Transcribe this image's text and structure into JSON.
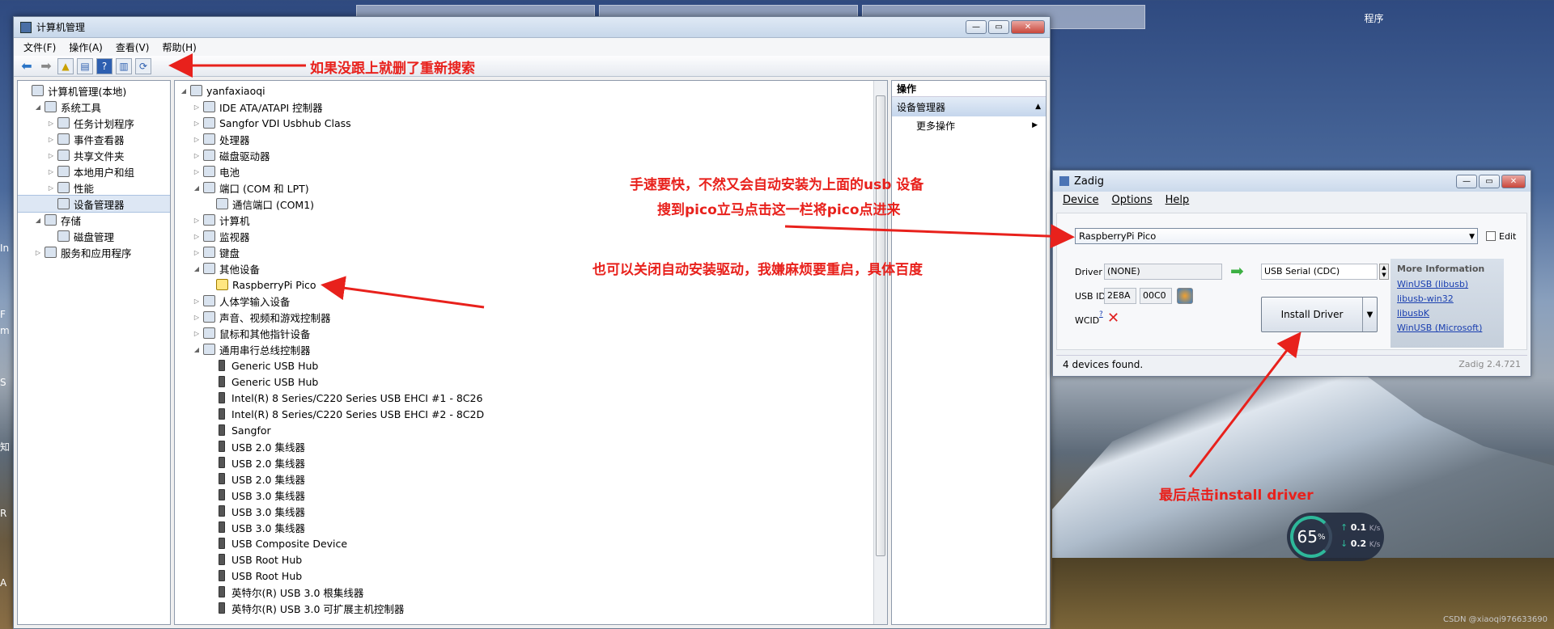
{
  "desktop": {
    "program_label": "程序",
    "left_edge": [
      "In",
      "F",
      "m",
      "S",
      "知",
      "R",
      "A"
    ],
    "watermark": "CSDN @xiaoqi976633690"
  },
  "devmgmt": {
    "title": "计算机管理",
    "menu": [
      "文件(F)",
      "操作(A)",
      "查看(V)",
      "帮助(H)"
    ],
    "left_tree": [
      {
        "label": "计算机管理(本地)",
        "indent": 0,
        "tri": ""
      },
      {
        "label": "系统工具",
        "indent": 1,
        "tri": "◢"
      },
      {
        "label": "任务计划程序",
        "indent": 2,
        "tri": "▷"
      },
      {
        "label": "事件查看器",
        "indent": 2,
        "tri": "▷"
      },
      {
        "label": "共享文件夹",
        "indent": 2,
        "tri": "▷"
      },
      {
        "label": "本地用户和组",
        "indent": 2,
        "tri": "▷"
      },
      {
        "label": "性能",
        "indent": 2,
        "tri": "▷"
      },
      {
        "label": "设备管理器",
        "indent": 2,
        "tri": "",
        "selected": true
      },
      {
        "label": "存储",
        "indent": 1,
        "tri": "◢"
      },
      {
        "label": "磁盘管理",
        "indent": 2,
        "tri": ""
      },
      {
        "label": "服务和应用程序",
        "indent": 1,
        "tri": "▷"
      }
    ],
    "device_tree": [
      {
        "label": "yanfaxiaoqi",
        "indent": 0,
        "tri": "◢",
        "type": "pc"
      },
      {
        "label": "IDE ATA/ATAPI 控制器",
        "indent": 1,
        "tri": "▷"
      },
      {
        "label": "Sangfor VDI Usbhub Class",
        "indent": 1,
        "tri": "▷"
      },
      {
        "label": "处理器",
        "indent": 1,
        "tri": "▷"
      },
      {
        "label": "磁盘驱动器",
        "indent": 1,
        "tri": "▷"
      },
      {
        "label": "电池",
        "indent": 1,
        "tri": "▷"
      },
      {
        "label": "端口 (COM 和 LPT)",
        "indent": 1,
        "tri": "◢"
      },
      {
        "label": "通信端口 (COM1)",
        "indent": 2,
        "tri": ""
      },
      {
        "label": "计算机",
        "indent": 1,
        "tri": "▷"
      },
      {
        "label": "监视器",
        "indent": 1,
        "tri": "▷"
      },
      {
        "label": "键盘",
        "indent": 1,
        "tri": "▷"
      },
      {
        "label": "其他设备",
        "indent": 1,
        "tri": "◢"
      },
      {
        "label": "RaspberryPi Pico",
        "indent": 2,
        "tri": "",
        "type": "warn"
      },
      {
        "label": "人体学输入设备",
        "indent": 1,
        "tri": "▷"
      },
      {
        "label": "声音、视频和游戏控制器",
        "indent": 1,
        "tri": "▷"
      },
      {
        "label": "鼠标和其他指针设备",
        "indent": 1,
        "tri": "▷"
      },
      {
        "label": "通用串行总线控制器",
        "indent": 1,
        "tri": "◢"
      },
      {
        "label": "Generic USB Hub",
        "indent": 2,
        "tri": "",
        "type": "usb"
      },
      {
        "label": "Generic USB Hub",
        "indent": 2,
        "tri": "",
        "type": "usb"
      },
      {
        "label": "Intel(R) 8 Series/C220 Series USB EHCI #1 - 8C26",
        "indent": 2,
        "tri": "",
        "type": "usb"
      },
      {
        "label": "Intel(R) 8 Series/C220 Series USB EHCI #2 - 8C2D",
        "indent": 2,
        "tri": "",
        "type": "usb"
      },
      {
        "label": "Sangfor",
        "indent": 2,
        "tri": "",
        "type": "usb"
      },
      {
        "label": "USB 2.0 集线器",
        "indent": 2,
        "tri": "",
        "type": "usb"
      },
      {
        "label": "USB 2.0 集线器",
        "indent": 2,
        "tri": "",
        "type": "usb"
      },
      {
        "label": "USB 2.0 集线器",
        "indent": 2,
        "tri": "",
        "type": "usb"
      },
      {
        "label": "USB 3.0 集线器",
        "indent": 2,
        "tri": "",
        "type": "usb"
      },
      {
        "label": "USB 3.0 集线器",
        "indent": 2,
        "tri": "",
        "type": "usb"
      },
      {
        "label": "USB 3.0 集线器",
        "indent": 2,
        "tri": "",
        "type": "usb"
      },
      {
        "label": "USB Composite Device",
        "indent": 2,
        "tri": "",
        "type": "usb"
      },
      {
        "label": "USB Root Hub",
        "indent": 2,
        "tri": "",
        "type": "usb"
      },
      {
        "label": "USB Root Hub",
        "indent": 2,
        "tri": "",
        "type": "usb"
      },
      {
        "label": "英特尔(R) USB 3.0 根集线器",
        "indent": 2,
        "tri": "",
        "type": "usb"
      },
      {
        "label": "英特尔(R) USB 3.0 可扩展主机控制器",
        "indent": 2,
        "tri": "",
        "type": "usb"
      }
    ],
    "actions": {
      "header": "操作",
      "section": "设备管理器",
      "more": "更多操作"
    }
  },
  "annotations": {
    "toolbar_note": "如果没跟上就删了重新搜索",
    "speed_note_1": "手速要快，不然又会自动安装为上面的usb 设备",
    "speed_note_2": "搜到pico立马点击这一栏将pico点进来",
    "disable_note": "也可以关闭自动安装驱动，我嫌麻烦要重启，具体百度",
    "install_note": "最后点击install driver",
    "color": "#e8211c"
  },
  "zadig": {
    "title": "Zadig",
    "menu": [
      "Device",
      "Options",
      "Help"
    ],
    "device_selected": "RaspberryPi Pico",
    "edit_label": "Edit",
    "driver_label": "Driver",
    "driver_current": "(NONE)",
    "driver_target": "USB Serial (CDC)",
    "usbid_label": "USB ID",
    "vid": "2E8A",
    "pid": "00C0",
    "wcid_label": "WCID",
    "wcid_sup": "?",
    "install_button": "Install Driver",
    "more_info_title": "More Information",
    "links": [
      "WinUSB (libusb)",
      "libusb-win32",
      "libusbK",
      "WinUSB (Microsoft)"
    ],
    "status": "4 devices found.",
    "version": "Zadig 2.4.721"
  },
  "net_gauge": {
    "percent": "65",
    "unit": "%",
    "up": "0.1",
    "down": "0.2",
    "rate_unit": "K/s"
  }
}
